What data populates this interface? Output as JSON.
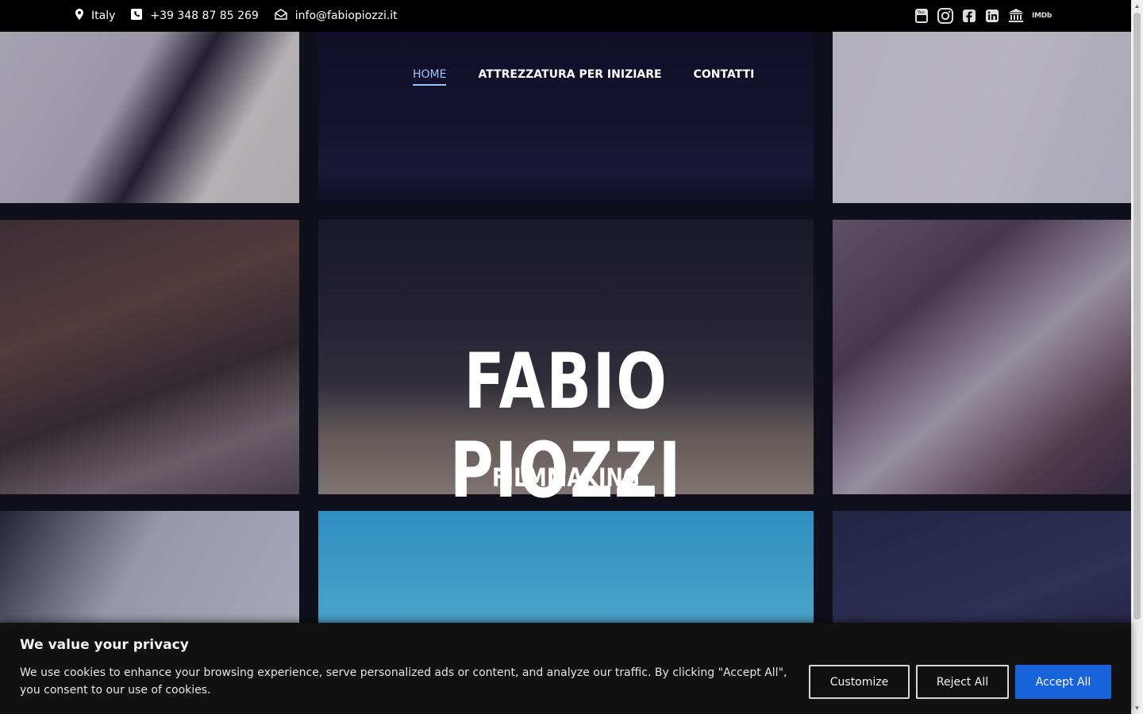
{
  "contact": {
    "location": "Italy",
    "phone": "+39 348 87 85 269",
    "email": "info@fabiopiozzi.it"
  },
  "social": {
    "imdb_label": "IMDb"
  },
  "nav": {
    "items": [
      {
        "label": "HOME",
        "active": true
      },
      {
        "label": "ATTREZZATURA PER INIZIARE",
        "active": false
      },
      {
        "label": "CONTATTI",
        "active": false
      }
    ]
  },
  "hero": {
    "title": "FABIO PIOZZI",
    "subtitle": "FILMMAKING"
  },
  "cookie": {
    "heading": "We value your privacy",
    "text": "We use cookies to enhance your browsing experience, serve personalized ads or content, and analyze our traffic. By clicking \"Accept All\", you consent to our use of cookies.",
    "customize_label": "Customize",
    "reject_label": "Reject All",
    "accept_label": "Accept All"
  },
  "colors": {
    "accent": "#1863dc",
    "nav_active": "#9ec3f6",
    "banner_bg": "#111111"
  }
}
